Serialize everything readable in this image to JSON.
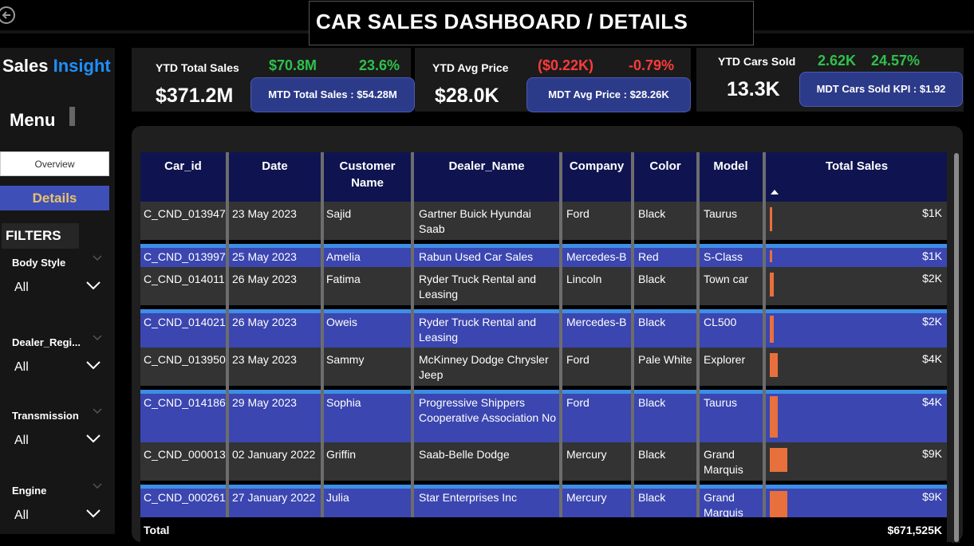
{
  "header": {
    "title": "CAR SALES DASHBOARD / DETAILS"
  },
  "sidebar": {
    "brand_part1": "Sales",
    "brand_part2": "Insight",
    "menu_title": "Menu",
    "nav": {
      "overview": "Overview",
      "details": "Details"
    },
    "filters_title": "FILTERS",
    "filters": [
      {
        "label": "Body Style",
        "value": "All"
      },
      {
        "label": "Dealer_Regi...",
        "value": "All"
      },
      {
        "label": "Transmission",
        "value": "All"
      },
      {
        "label": "Engine",
        "value": "All"
      }
    ]
  },
  "kpis": {
    "sales": {
      "label": "YTD Total Sales",
      "value": "$371.2M",
      "delta_value": "$70.8M",
      "delta_pct": "23.6%",
      "mtd": "MTD Total Sales : $54.28M"
    },
    "price": {
      "label": "YTD Avg Price",
      "value": "$28.0K",
      "delta_value": "($0.22K)",
      "delta_pct": "-0.79%",
      "mtd": "MDT Avg Price : $28.26K"
    },
    "cars": {
      "label": "YTD Cars Sold",
      "value": "13.3K",
      "delta_value": "2.62K",
      "delta_pct": "24.57%",
      "mtd": "MDT Cars Sold KPI : $1.92"
    }
  },
  "table": {
    "columns": [
      "Car_id",
      "Date",
      "Customer Name",
      "Dealer_Name",
      "Company",
      "Color",
      "Model",
      "Total Sales"
    ],
    "rows": [
      {
        "car_id": "C_CND_013947",
        "date": "23 May 2023",
        "customer": "Sajid",
        "dealer": "Gartner Buick Hyundai Saab",
        "company": "Ford",
        "color": "Black",
        "model": "Taurus",
        "sales": "$1K",
        "sales_k": 1
      },
      {
        "car_id": "C_CND_013997",
        "date": "25 May 2023",
        "customer": "Amelia",
        "dealer": "Rabun Used Car Sales",
        "company": "Mercedes-B",
        "color": "Red",
        "model": "S-Class",
        "sales": "$1K",
        "sales_k": 1
      },
      {
        "car_id": "C_CND_014011",
        "date": "26 May 2023",
        "customer": "Fatima",
        "dealer": "Ryder Truck Rental and Leasing",
        "company": "Lincoln",
        "color": "Black",
        "model": "Town car",
        "sales": "$2K",
        "sales_k": 2
      },
      {
        "car_id": "C_CND_014021",
        "date": "26 May 2023",
        "customer": "Oweis",
        "dealer": "Ryder Truck Rental and Leasing",
        "company": "Mercedes-B",
        "color": "Black",
        "model": "CL500",
        "sales": "$2K",
        "sales_k": 2
      },
      {
        "car_id": "C_CND_013950",
        "date": "23 May 2023",
        "customer": "Sammy",
        "dealer": "McKinney Dodge Chrysler Jeep",
        "company": "Ford",
        "color": "Pale White",
        "model": "Explorer",
        "sales": "$4K",
        "sales_k": 4
      },
      {
        "car_id": "C_CND_014186",
        "date": "29 May 2023",
        "customer": "Sophia",
        "dealer": "Progressive Shippers Cooperative Association No",
        "company": "Ford",
        "color": "Black",
        "model": "Taurus",
        "sales": "$4K",
        "sales_k": 4
      },
      {
        "car_id": "C_CND_000013",
        "date": "02 January 2022",
        "customer": "Griffin",
        "dealer": "Saab-Belle Dodge",
        "company": "Mercury",
        "color": "Black",
        "model": "Grand Marquis",
        "sales": "$9K",
        "sales_k": 9
      },
      {
        "car_id": "C_CND_000261",
        "date": "27 January 2022",
        "customer": "Julia",
        "dealer": "Star Enterprises Inc",
        "company": "Mercury",
        "color": "Black",
        "model": "Grand Marquis",
        "sales": "$9K",
        "sales_k": 9
      }
    ],
    "total_label": "Total",
    "total_value": "$671,525K"
  },
  "colors": {
    "accent_blue": "#3b46b0",
    "bar": "#e8703c",
    "positive": "#2ec14a",
    "negative": "#ff3b3b"
  }
}
